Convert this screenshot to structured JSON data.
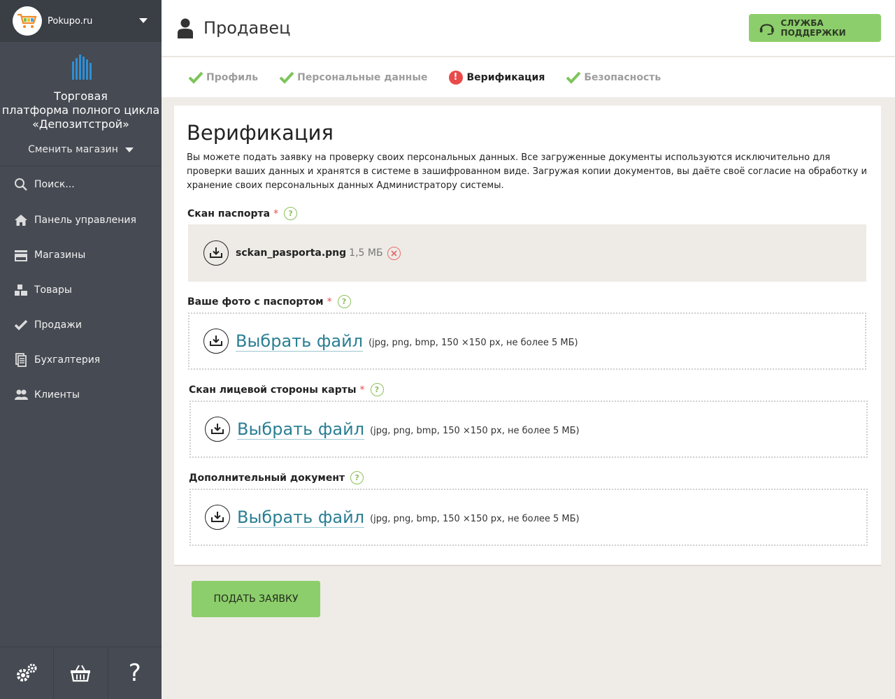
{
  "sidebar": {
    "store_name": "Pokupo.ru",
    "brand_line1": "Торговая",
    "brand_line2": "платформа полного цикла",
    "brand_line3": "«Депозитстрой»",
    "change_store": "Сменить магазин",
    "search_label": "Поиск...",
    "items": [
      {
        "label": "Панель управления",
        "icon": "home-icon"
      },
      {
        "label": "Магазины",
        "icon": "store-icon"
      },
      {
        "label": "Товары",
        "icon": "boxes-icon"
      },
      {
        "label": "Продажи",
        "icon": "check-icon"
      },
      {
        "label": "Бухгалтерия",
        "icon": "documents-icon"
      },
      {
        "label": "Клиенты",
        "icon": "users-icon"
      }
    ],
    "bottom": {
      "help_glyph": "?"
    }
  },
  "header": {
    "title": "Продавец",
    "support_label": "СЛУЖБА ПОДДЕРЖКИ"
  },
  "tabs": [
    {
      "label": "Профиль",
      "status": "done"
    },
    {
      "label": "Персональные данные",
      "status": "done"
    },
    {
      "label": "Верификация",
      "status": "error"
    },
    {
      "label": "Безопасность",
      "status": "done"
    }
  ],
  "form": {
    "title": "Верификация",
    "intro": "Вы можете подать заявку на проверку своих персональных данных. Все загруженные документы используются исключительно для проверки ваших данных и хранятся в системе в зашифрованном виде. Загружая копии документов, вы даёте своё согласие на обработку и хранение своих персональных данных Администратору системы.",
    "help_glyph": "?",
    "required_mark": "*",
    "passport_scan": {
      "label": "Скан паспорта",
      "file_name": "sckan_pasporta.png",
      "file_size": "1,5 МБ"
    },
    "photo_with_passport": {
      "label": "Ваше фото с паспортом",
      "choose": "Выбрать файл",
      "hint": "(jpg, png, bmp, 150 ×150 px, не более 5 МБ)"
    },
    "card_front": {
      "label": "Скан лицевой стороны карты",
      "choose": "Выбрать файл",
      "hint": "(jpg, png, bmp, 150 ×150 px, не более 5 МБ)"
    },
    "additional_doc": {
      "label": "Дополнительный документ",
      "choose": "Выбрать файл",
      "hint": "(jpg, png, bmp, 150 ×150 px, не более 5 МБ)"
    },
    "submit_label": "ПОДАТЬ ЗАЯВКУ"
  },
  "colors": {
    "accent_green": "#8dce6c",
    "link_blue": "#2b7f93",
    "sidebar_bg": "#464a52",
    "error_red": "#e94a4a"
  }
}
